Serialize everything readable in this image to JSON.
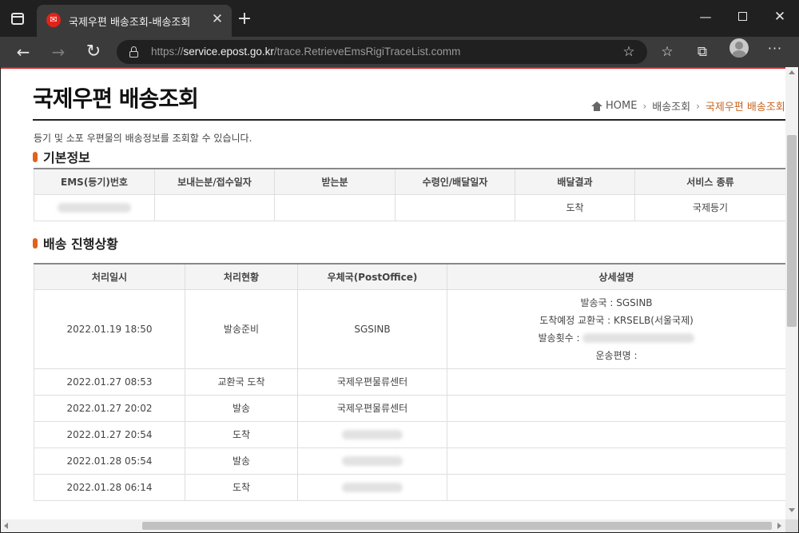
{
  "browser": {
    "tab_title": "국제우편 배송조회-배송조회",
    "url_prefix": "https://",
    "url_host": "service.epost.go.kr",
    "url_path": "/trace.RetrieveEmsRigiTraceList.comm"
  },
  "page": {
    "title": "국제우편 배송조회",
    "breadcrumb": [
      "HOME",
      "배송조회",
      "국제우편 배송조회"
    ],
    "description": "등기 및 소포 우편물의 배송정보를 조회할 수 있습니다.",
    "accent_color": "#e2611b"
  },
  "basic_info": {
    "section_title": "기본정보",
    "headers": [
      "EMS(등기)번호",
      "보내는분/접수일자",
      "받는분",
      "수령인/배달일자",
      "배달결과",
      "서비스 종류"
    ],
    "row": {
      "delivery_result": "도착",
      "service_type": "국제등기"
    }
  },
  "progress": {
    "section_title": "배송 진행상황",
    "headers": [
      "처리일시",
      "처리현황",
      "우체국(PostOffice)",
      "상세설명"
    ],
    "first_row": {
      "datetime": "2022.01.19 18:50",
      "status": "발송준비",
      "office": "SGSINB",
      "detail_1": "발송국 : SGSINB",
      "detail_2": "도착예정 교환국 : KRSELB(서울국제)",
      "detail_3": "발송횟수 :",
      "detail_4": "운송편명 :"
    },
    "rows": [
      {
        "datetime": "2022.01.27 08:53",
        "status": "교환국 도착",
        "office": "국제우편물류센터"
      },
      {
        "datetime": "2022.01.27 20:02",
        "status": "발송",
        "office": "국제우편물류센터"
      },
      {
        "datetime": "2022.01.27 20:54",
        "status": "도착",
        "office": ""
      },
      {
        "datetime": "2022.01.28 05:54",
        "status": "발송",
        "office": ""
      },
      {
        "datetime": "2022.01.28 06:14",
        "status": "도착",
        "office": ""
      }
    ]
  }
}
